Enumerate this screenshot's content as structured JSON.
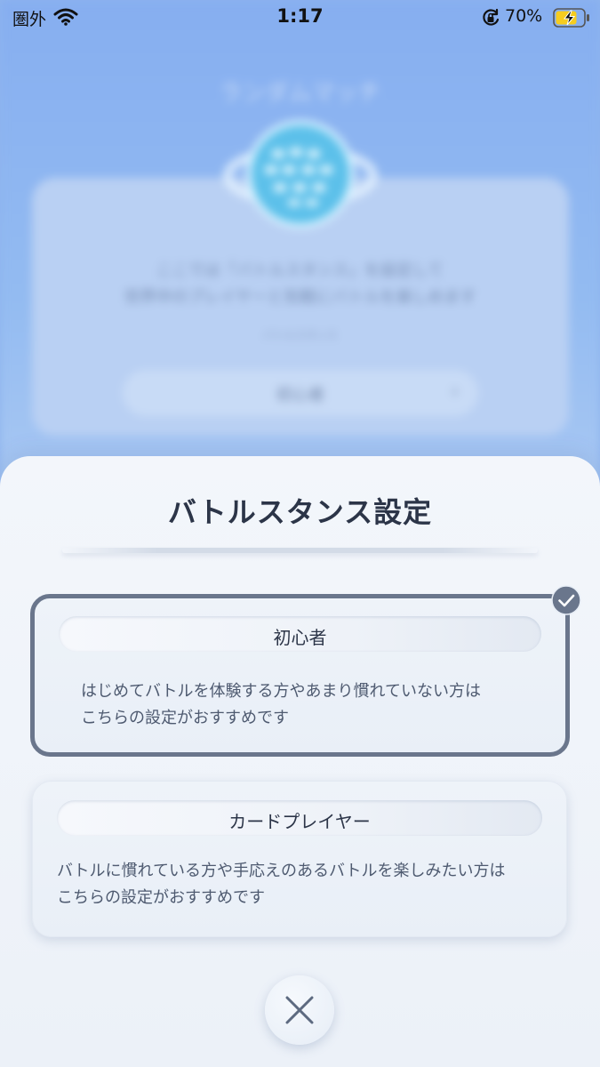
{
  "status_bar": {
    "carrier": "圏外",
    "time": "1:17",
    "battery_percent": "70%",
    "icons": [
      "wifi-icon",
      "rotation-lock-icon",
      "battery-charging-icon"
    ]
  },
  "background": {
    "title": "ランダムマッチ",
    "description_line1": "ここでは「バトルスタンス」を設定して",
    "description_line2": "世界中のプレイヤーと気軽にバトルを楽しめます",
    "sublabel": "バトルスタンス",
    "current_stance": "初心者"
  },
  "sheet": {
    "title": "バトルスタンス設定",
    "options": [
      {
        "name": "初心者",
        "description_line1": "はじめてバトルを体験する方やあまり慣れていない方は",
        "description_line2": "こちらの設定がおすすめです",
        "selected": true
      },
      {
        "name": "カードプレイヤー",
        "description_line1": "バトルに慣れている方や手応えのあるバトルを楽しみたい方は",
        "description_line2": "こちらの設定がおすすめです",
        "selected": false
      }
    ]
  },
  "colors": {
    "selected_border": "#6a768c",
    "title_text": "#2c3548",
    "background_blue": "#8fb5ee"
  }
}
